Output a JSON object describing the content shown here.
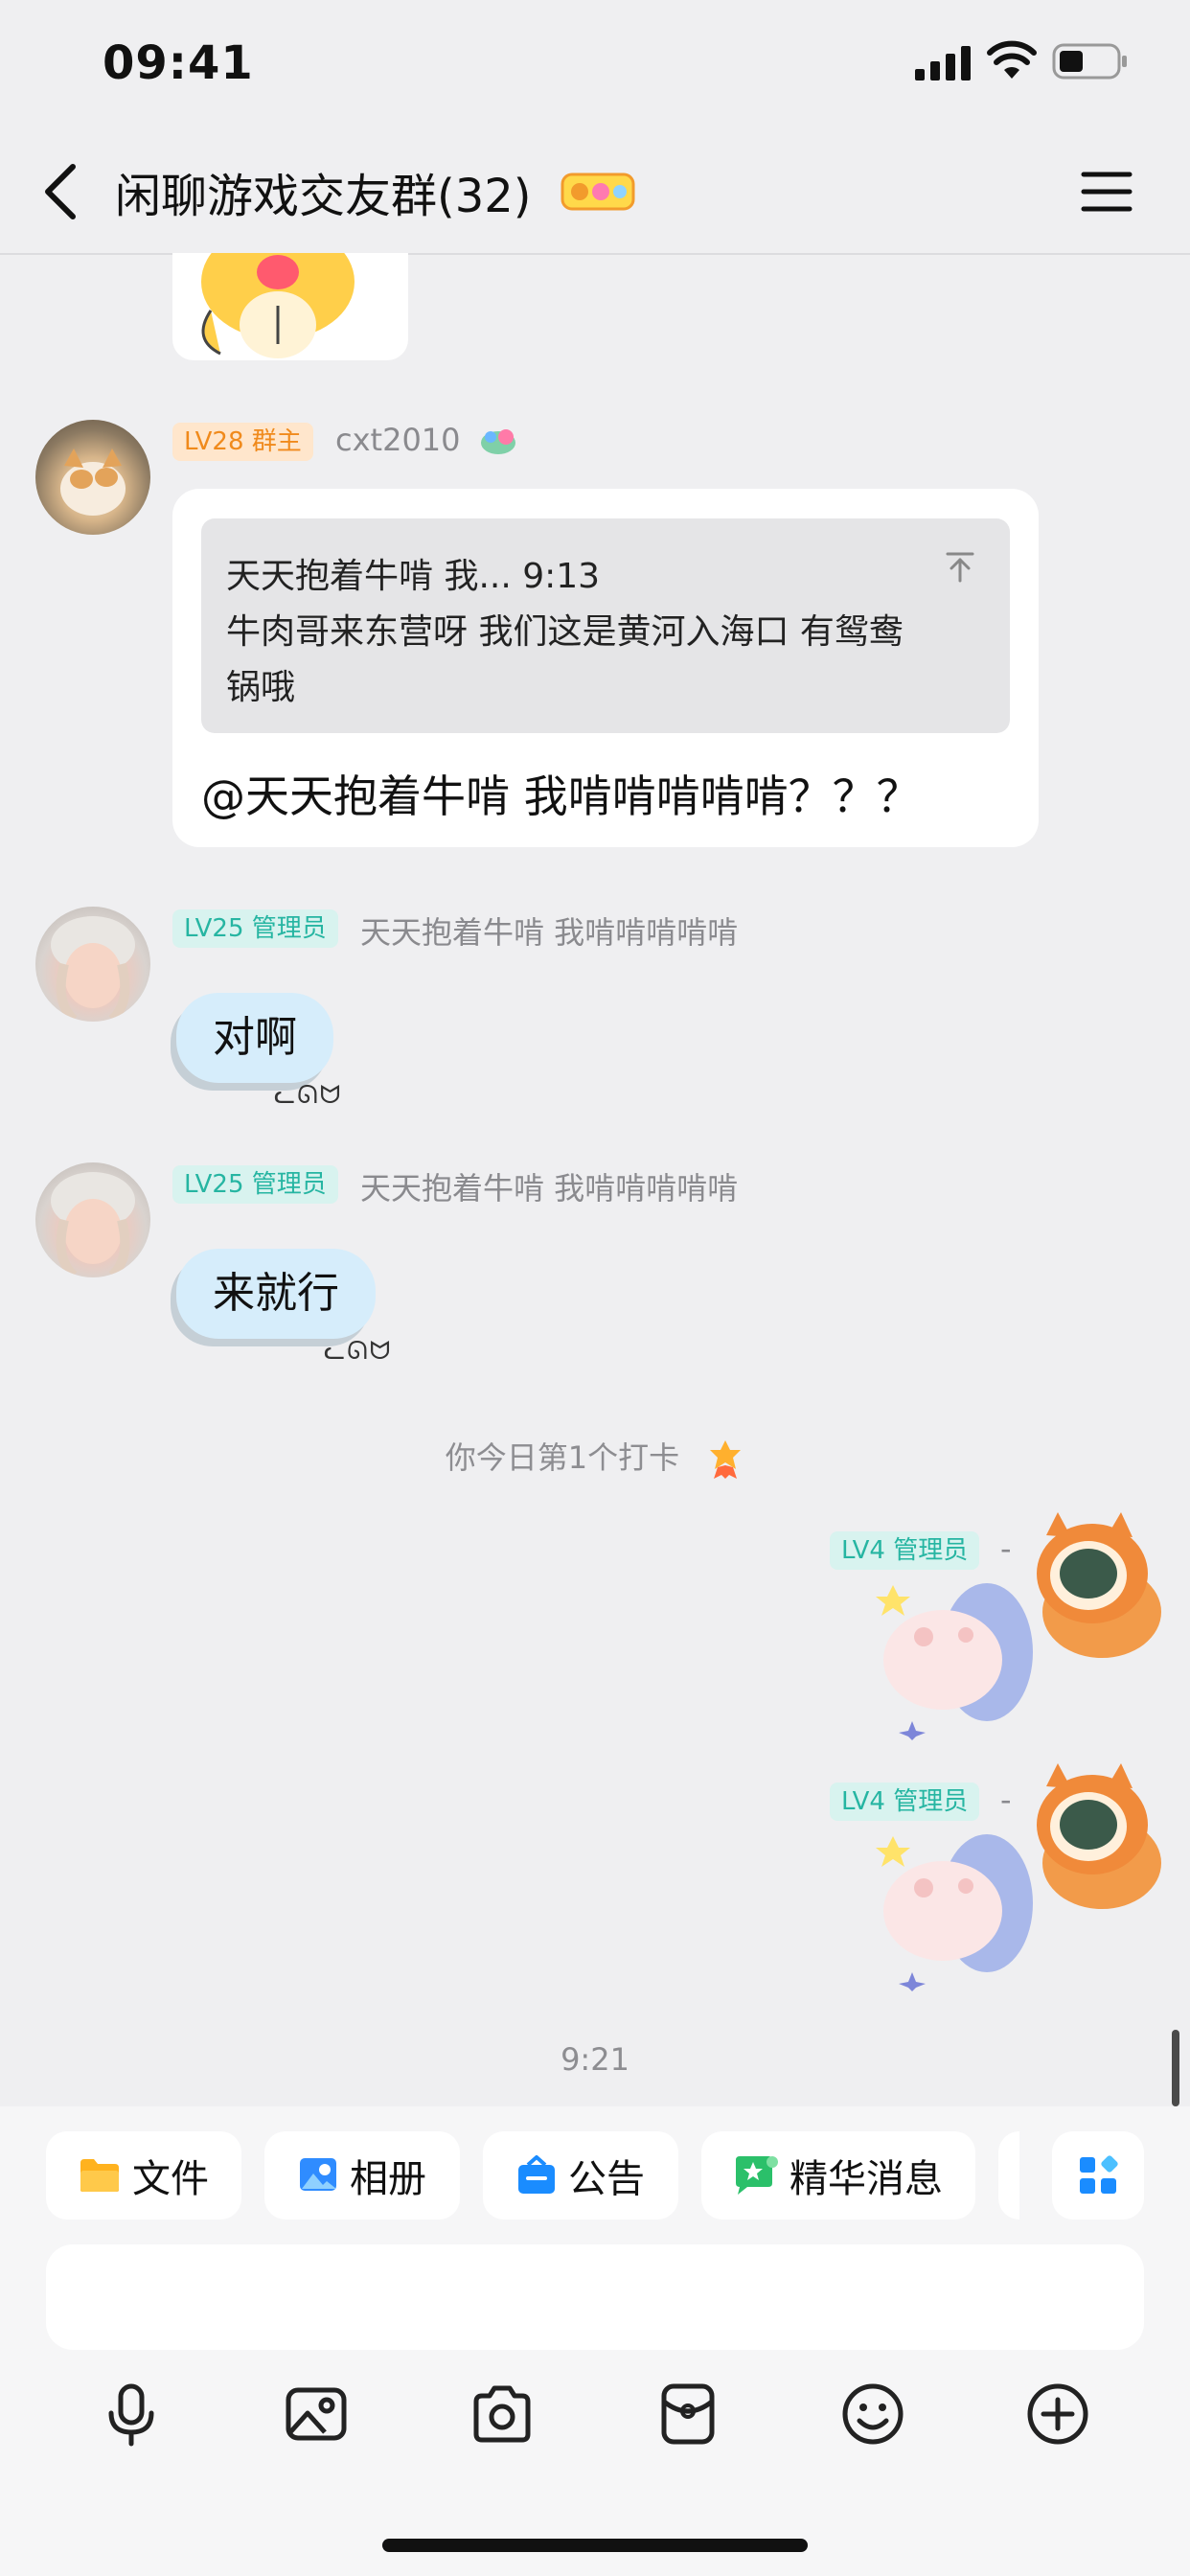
{
  "status_bar": {
    "time": "09:41"
  },
  "header": {
    "title": "闲聊游戏交友群(32)"
  },
  "messages": [
    {
      "level": "LV28 群主",
      "sender": "cxt2010",
      "quote_head": "天天抱着牛啃  我... 9:13",
      "quote_body_1": "牛肉哥来东营呀 我们这是黄河入海口 有鸳鸯",
      "quote_body_2": "锅哦",
      "text": "@天天抱着牛啃 我啃啃啃啃啃？？？"
    },
    {
      "level": "LV25 管理员",
      "sender": "天天抱着牛啃  我啃啃啃啃啃",
      "text": "对啊",
      "deco": "ᓚᘏᗢ"
    },
    {
      "level": "LV25 管理员",
      "sender": "天天抱着牛啃  我啃啃啃啃啃",
      "text": "来就行",
      "deco": "ᓚᘏᗢ"
    },
    {
      "level": "LV4 管理员",
      "sender": "-"
    },
    {
      "level": "LV4 管理员",
      "sender": "-"
    }
  ],
  "checkin": "你今日第1个打卡",
  "time_separator": "9:21",
  "quick_actions": [
    {
      "label": "文件",
      "icon": "folder-icon"
    },
    {
      "label": "相册",
      "icon": "photo-album-icon"
    },
    {
      "label": "公告",
      "icon": "announcement-icon"
    },
    {
      "label": "精华消息",
      "icon": "essence-message-icon"
    }
  ],
  "toolbar_icons": [
    "microphone-icon",
    "image-icon",
    "camera-icon",
    "red-packet-icon",
    "emoji-icon",
    "plus-icon"
  ],
  "colors": {
    "accent_blue": "#1a8cff",
    "owner_tag": "#f08a1c",
    "admin_tag": "#26b5a2",
    "bubble_blue": "#d6edfb"
  }
}
